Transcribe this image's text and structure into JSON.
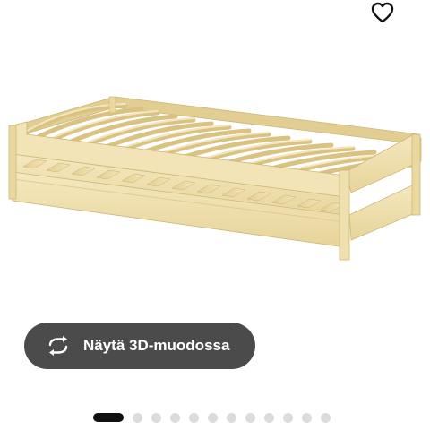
{
  "favorite": {
    "icon": "heart-outline-icon"
  },
  "product_image": {
    "subject": "stackable pine bed frame with slatted bases",
    "wood_color": "#efe0b0"
  },
  "view_3d": {
    "label": "Näytä 3D-muodossa",
    "icon": "rotate-arrows-icon",
    "background": "#4b4b4b"
  },
  "carousel": {
    "total": 13,
    "active_index": 0
  }
}
